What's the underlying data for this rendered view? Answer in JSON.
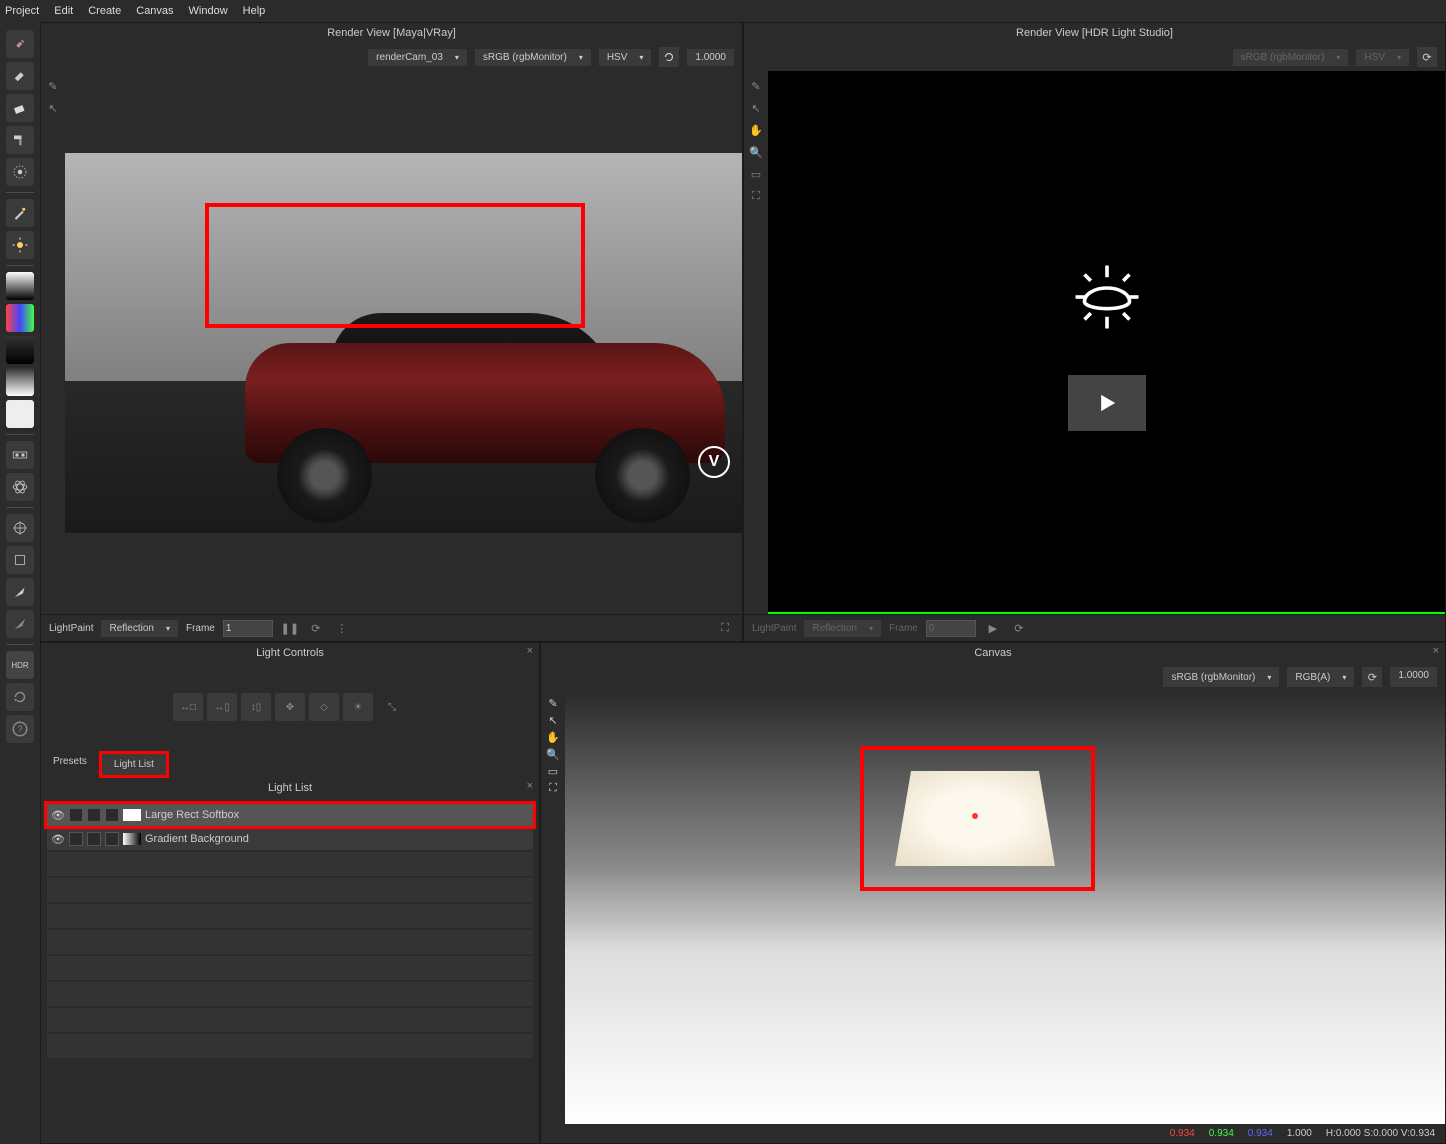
{
  "menu": {
    "project": "Project",
    "edit": "Edit",
    "create": "Create",
    "canvas": "Canvas",
    "window": "Window",
    "help": "Help"
  },
  "render_left": {
    "title": "Render View [Maya|VRay]",
    "camera": "renderCam_03",
    "colorspace": "sRGB (rgbMonitor)",
    "mode": "HSV",
    "value": "1.0000",
    "lightpaint": "LightPaint",
    "reflection": "Reflection",
    "frame_label": "Frame",
    "frame": "1"
  },
  "render_right": {
    "title": "Render View [HDR Light Studio]",
    "colorspace": "sRGB (rgbMonitor)",
    "mode": "HSV",
    "lightpaint": "LightPaint",
    "reflection": "Reflection",
    "frame_label": "Frame",
    "frame": "0"
  },
  "light_controls": {
    "title": "Light Controls"
  },
  "tabs": {
    "presets": "Presets",
    "lightlist": "Light List"
  },
  "lightlist": {
    "title": "Light List",
    "items": [
      {
        "name": "Large Rect Softbox",
        "selected": true
      },
      {
        "name": "Gradient Background",
        "selected": false
      }
    ]
  },
  "canvas": {
    "title": "Canvas",
    "colorspace": "sRGB (rgbMonitor)",
    "mode": "RGB(A)",
    "value": "1.0000",
    "footer": {
      "r": "0.934",
      "g": "0.934",
      "b": "0.934",
      "a": "1.000",
      "hsv": "H:0.000 S:0.000 V:0.934"
    }
  },
  "toolbar_label": {
    "hdr": "HDR"
  }
}
